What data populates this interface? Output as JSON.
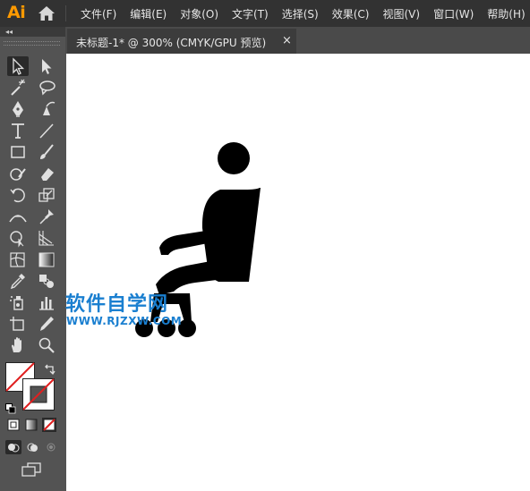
{
  "app": {
    "logo_text": "Ai",
    "accent_color": "#ff9a00"
  },
  "menubar": {
    "items": [
      "文件(F)",
      "编辑(E)",
      "对象(O)",
      "文字(T)",
      "选择(S)",
      "效果(C)",
      "视图(V)",
      "窗口(W)",
      "帮助(H)"
    ]
  },
  "toolbar": {
    "collapse_glyph": "◂◂",
    "tools": [
      {
        "name": "selection-tool",
        "icon": "arrow-icon",
        "selected": true
      },
      {
        "name": "direct-selection-tool",
        "icon": "white-arrow-icon"
      },
      {
        "name": "magic-wand-tool",
        "icon": "magic-wand-icon"
      },
      {
        "name": "lasso-tool",
        "icon": "lasso-icon"
      },
      {
        "name": "pen-tool",
        "icon": "pen-icon"
      },
      {
        "name": "curvature-tool",
        "icon": "curvature-pen-icon"
      },
      {
        "name": "type-tool",
        "icon": "type-icon"
      },
      {
        "name": "line-tool",
        "icon": "line-icon"
      },
      {
        "name": "rectangle-tool",
        "icon": "rectangle-icon"
      },
      {
        "name": "paintbrush-tool",
        "icon": "paintbrush-icon"
      },
      {
        "name": "shaper-tool",
        "icon": "shaper-icon"
      },
      {
        "name": "eraser-tool",
        "icon": "eraser-icon"
      },
      {
        "name": "rotate-tool",
        "icon": "rotate-icon"
      },
      {
        "name": "scale-tool",
        "icon": "scale-icon"
      },
      {
        "name": "width-tool",
        "icon": "width-icon"
      },
      {
        "name": "puppet-warp-tool",
        "icon": "pin-icon"
      },
      {
        "name": "shape-builder-tool",
        "icon": "shape-builder-icon"
      },
      {
        "name": "perspective-grid-tool",
        "icon": "perspective-icon"
      },
      {
        "name": "mesh-tool",
        "icon": "mesh-icon"
      },
      {
        "name": "gradient-tool",
        "icon": "gradient-icon"
      },
      {
        "name": "eyedropper-tool",
        "icon": "eyedropper-icon"
      },
      {
        "name": "blend-tool",
        "icon": "blend-icon"
      },
      {
        "name": "symbol-sprayer-tool",
        "icon": "symbol-sprayer-icon"
      },
      {
        "name": "graph-tool",
        "icon": "bar-graph-icon"
      },
      {
        "name": "artboard-tool",
        "icon": "artboard-icon"
      },
      {
        "name": "slice-tool",
        "icon": "slice-icon"
      },
      {
        "name": "hand-tool",
        "icon": "hand-icon"
      },
      {
        "name": "zoom-tool",
        "icon": "zoom-icon"
      }
    ],
    "fill_color": "#ffffff",
    "stroke_color": "#000000"
  },
  "document": {
    "tab_title": "未标题-1* @ 300% (CMYK/GPU 预览)",
    "close_glyph": "×"
  },
  "watermark": {
    "title": "软件自学网",
    "url": "WWW.RJZXW.COM",
    "color": "#1a7fd0"
  }
}
